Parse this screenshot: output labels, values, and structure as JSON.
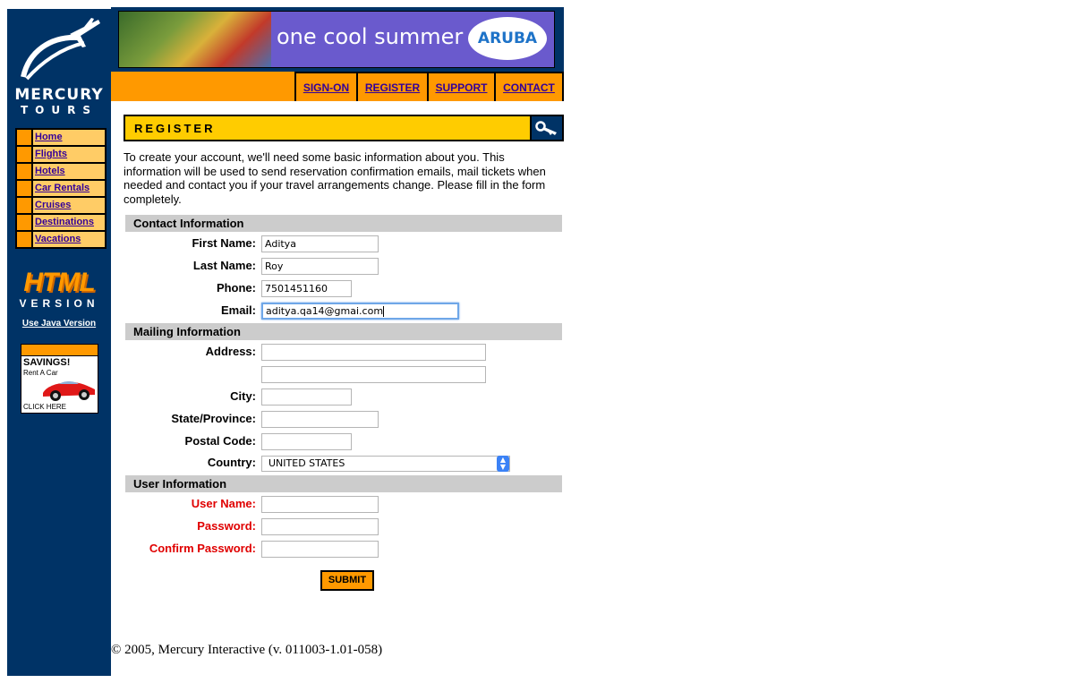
{
  "brand": {
    "line1": "MERCURY",
    "line2": "TOURS"
  },
  "leftnav": {
    "items": [
      {
        "label": "Home"
      },
      {
        "label": "Flights"
      },
      {
        "label": "Hotels"
      },
      {
        "label": "Car Rentals"
      },
      {
        "label": "Cruises"
      },
      {
        "label": "Destinations"
      },
      {
        "label": "Vacations"
      }
    ]
  },
  "htmlversion": {
    "html_text": "HTML",
    "version_text": "VERSION",
    "java_link": "Use Java Version"
  },
  "ad": {
    "headline": "SAVINGS!",
    "subline": "Rent A Car",
    "cta": "CLICK HERE"
  },
  "banner": {
    "tagline": "one cool summer",
    "logo_text": "ARUBA"
  },
  "topnav": {
    "tabs": [
      {
        "label": "SIGN-ON"
      },
      {
        "label": "REGISTER"
      },
      {
        "label": "SUPPORT"
      },
      {
        "label": "CONTACT"
      }
    ]
  },
  "page": {
    "title": "REGISTER",
    "intro": "To create your account, we'll need some basic information about you. This information will be used to send reservation confirmation emails, mail tickets when needed and contact you if your travel arrangements change. Please fill in the form completely."
  },
  "form": {
    "contact_heading": "Contact Information",
    "first_name_label": "First Name:",
    "first_name_value": "Aditya",
    "last_name_label": "Last Name:",
    "last_name_value": "Roy",
    "phone_label": "Phone:",
    "phone_value": "7501451160",
    "email_label": "Email:",
    "email_value": "aditya.qa14@gmai.com",
    "mailing_heading": "Mailing Information",
    "address_label": "Address:",
    "address1_value": "",
    "address2_value": "",
    "city_label": "City:",
    "city_value": "",
    "state_label": "State/Province:",
    "state_value": "",
    "postal_label": "Postal Code:",
    "postal_value": "",
    "country_label": "Country:",
    "country_value": "UNITED STATES",
    "user_heading": "User Information",
    "username_label": "User Name:",
    "username_value": "",
    "password_label": "Password:",
    "password_value": "",
    "confirm_label": "Confirm Password:",
    "confirm_value": "",
    "submit_label": "SUBMIT"
  },
  "footer": {
    "text": "© 2005, Mercury Interactive (v. 011003-1.01-058)"
  },
  "colors": {
    "navy": "#003366",
    "orange": "#ff9900",
    "yellow": "#ffcc00",
    "link": "#330099",
    "required": "#e00000"
  }
}
